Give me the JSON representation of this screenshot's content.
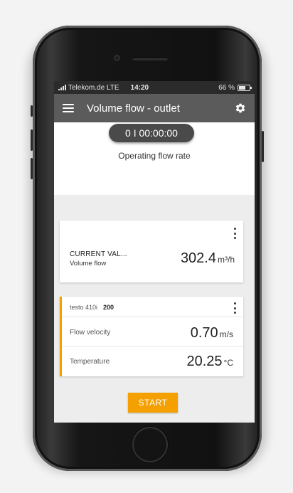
{
  "status_bar": {
    "carrier": "Telekom.de  LTE",
    "time": "14:20",
    "battery": "66 %"
  },
  "app_bar": {
    "title": "Volume flow - outlet",
    "menu_icon": "menu-icon",
    "settings_icon": "gear-icon"
  },
  "timer": {
    "value": "0 I 00:00:00",
    "caption": "Operating flow rate"
  },
  "current_value_card": {
    "label": "CURRENT VAL...",
    "sublabel": "Volume flow",
    "value": "302.4",
    "unit": "m³/h",
    "menu_icon": "kebab-icon"
  },
  "device_card": {
    "device_name": "testo 410i",
    "device_code": "200",
    "menu_icon": "kebab-icon",
    "accent_color": "#f4a000",
    "rows": [
      {
        "label": "Flow velocity",
        "value": "0.70",
        "unit": "m/s"
      },
      {
        "label": "Temperature",
        "value": "20.25",
        "unit": "°C"
      }
    ]
  },
  "start_button": {
    "label": "START",
    "color": "#f4a000"
  }
}
